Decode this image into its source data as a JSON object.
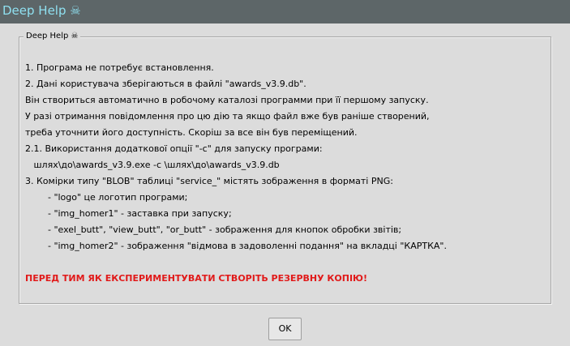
{
  "window": {
    "title": "Deep Help ☠"
  },
  "group": {
    "legend": "Deep Help ☠"
  },
  "help_lines": [
    "1. Програма не потребує встановлення.",
    "2. Дані користувача зберігаються в файлі \"awards_v3.9.db\".",
    "Він створиться автоматично в робочому каталозі программи при її першому запуску.",
    "У разі отримання повідомлення про цю дію та якщо файл вже був раніше створений,",
    "треба уточнити його доступність. Скоріш за все він був переміщений.",
    "2.1. Використання додаткової опції \"-c\" для запуску програми:",
    "   шлях\\до\\awards_v3.9.exe -c \\шлях\\до\\awards_v3.9.db",
    "3. Комірки типу \"BLOB\" таблиці \"service_\" містять зображення в форматі PNG:",
    "        - \"logo\" це логотип програми;",
    "        - \"img_homer1\" - заставка при запуску;",
    "        - \"exel_butt\", \"view_butt\", \"or_butt\" - зображення для кнопок обробки звітів;",
    "        - \"img_homer2\" - зображення \"відмова в задоволенні подання\" на вкладці \"КАРТКА\"."
  ],
  "warning": "ПЕРЕД ТИМ ЯК ЕКСПЕРИМЕНТУВАТИ СТВОРІТЬ РЕЗЕРВНУ КОПІЮ!",
  "buttons": {
    "ok_label": "OK"
  },
  "colors": {
    "titlebar_bg": "#5d6668",
    "title_text": "#8fe0f0",
    "warning_text": "#e11a1a",
    "window_bg": "#dcdcdc"
  }
}
